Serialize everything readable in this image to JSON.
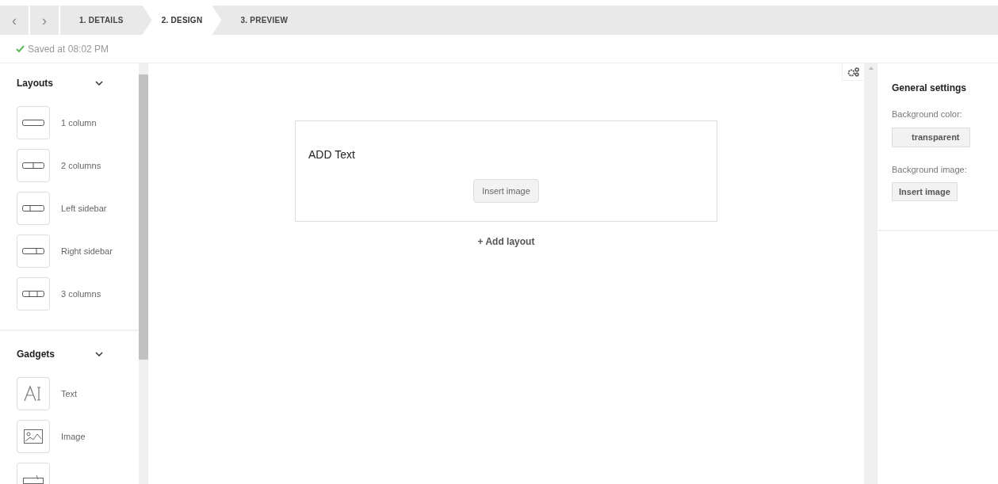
{
  "nav": {
    "back": "‹",
    "forward": "›"
  },
  "steps": [
    {
      "label": "1. DETAILS",
      "selected": false
    },
    {
      "label": "2. DESIGN",
      "selected": true
    },
    {
      "label": "3. PREVIEW",
      "selected": false
    }
  ],
  "status": "Saved at 08:02 PM",
  "sidebar": {
    "sections": [
      {
        "title": "Layouts",
        "expanded": true,
        "items": [
          {
            "kind": "one",
            "label": "1 column"
          },
          {
            "kind": "two",
            "label": "2 columns"
          },
          {
            "kind": "left",
            "label": "Left sidebar"
          },
          {
            "kind": "right",
            "label": "Right sidebar"
          },
          {
            "kind": "three",
            "label": "3 columns"
          }
        ]
      },
      {
        "title": "Gadgets",
        "expanded": true,
        "items": [
          {
            "kind": "text",
            "label": "Text"
          },
          {
            "kind": "image",
            "label": "Image"
          },
          {
            "kind": "button"
          }
        ]
      }
    ]
  },
  "canvas": {
    "block_text": "ADD Text",
    "insert_button": "Insert image",
    "add_layout": "+ Add layout"
  },
  "settings": {
    "title": "General settings",
    "bg_color_label": "Background color:",
    "bg_color_value": "transparent",
    "bg_image_label": "Background image:",
    "bg_image_button": "Insert image"
  }
}
